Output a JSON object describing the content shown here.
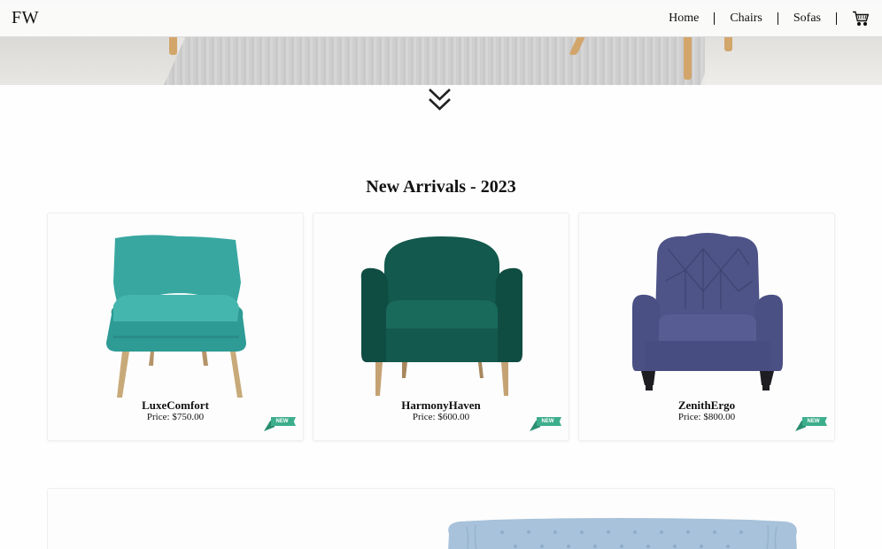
{
  "navbar": {
    "brand": "FW",
    "links": [
      {
        "label": "Home"
      },
      {
        "label": "Chairs"
      },
      {
        "label": "Sofas"
      }
    ],
    "cart_icon": "shopping-cart-icon"
  },
  "hero": {
    "scroll_icon": "double-chevron-down-icon"
  },
  "new_arrivals": {
    "title": "New Arrivals - 2023",
    "products": [
      {
        "name": "LuxeComfort",
        "price": "Price: $750.00",
        "badge": "NEW",
        "color": "#3aa9a3"
      },
      {
        "name": "HarmonyHaven",
        "price": "Price: $600.00",
        "badge": "NEW",
        "color": "#135a4e"
      },
      {
        "name": "ZenithErgo",
        "price": "Price: $800.00",
        "badge": "NEW",
        "color": "#4f5589"
      }
    ]
  },
  "colors": {
    "badge": "#3dae8c",
    "sofa": "#a9c4dc"
  }
}
